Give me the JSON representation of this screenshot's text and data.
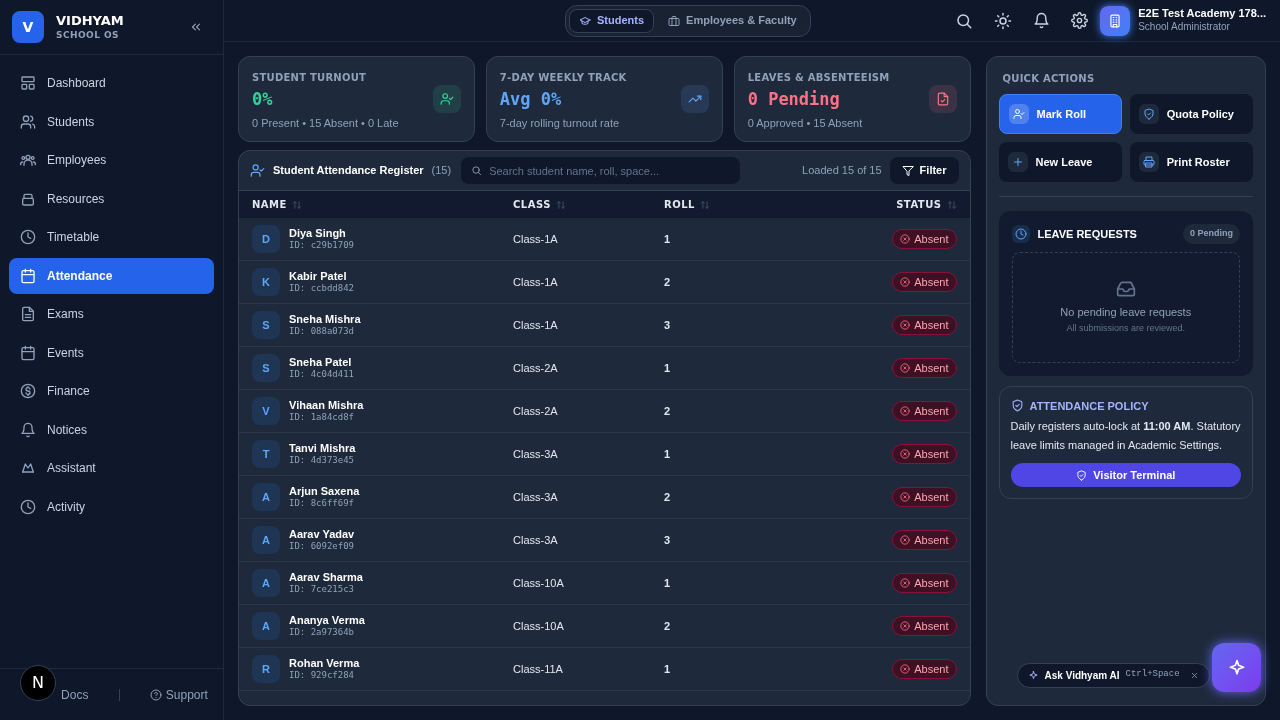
{
  "brand": {
    "logo_letter": "V",
    "name": "VIDHYAM",
    "subtitle": "SCHOOL OS"
  },
  "sidebar": {
    "items": [
      {
        "label": "Dashboard",
        "selected": false
      },
      {
        "label": "Students",
        "selected": false
      },
      {
        "label": "Employees",
        "selected": false
      },
      {
        "label": "Resources",
        "selected": false
      },
      {
        "label": "Timetable",
        "selected": false
      },
      {
        "label": "Attendance",
        "selected": true
      },
      {
        "label": "Exams",
        "selected": false
      },
      {
        "label": "Events",
        "selected": false
      },
      {
        "label": "Finance",
        "selected": false
      },
      {
        "label": "Notices",
        "selected": false
      },
      {
        "label": "Assistant",
        "selected": false
      },
      {
        "label": "Activity",
        "selected": false
      }
    ],
    "footer_links": [
      "Docs",
      "Support"
    ]
  },
  "dev_badge": "N",
  "header": {
    "tabs": [
      {
        "label": "Students",
        "selected": true
      },
      {
        "label": "Employees & Faculty",
        "selected": false
      }
    ],
    "user": {
      "name": "E2E Test Academy 178...",
      "role": "School Administrator"
    }
  },
  "stats": [
    {
      "title": "STUDENT TURNOUT",
      "value": "0%",
      "detail": "0 Present • 15 Absent • 0 Late",
      "color": "#34d399"
    },
    {
      "title": "7-DAY WEEKLY TRACK",
      "value": "Avg 0%",
      "detail": "7-day rolling turnout rate",
      "color": "#60a5fa"
    },
    {
      "title": "LEAVES & ABSENTEEISM",
      "value": "0 Pending",
      "detail": "0 Approved • 15 Absent",
      "color": "#fb7185"
    }
  ],
  "register": {
    "title": "Student Attendance Register",
    "count": "(15)",
    "search_placeholder": "Search student name, roll, space...",
    "loaded": "Loaded 15 of 15",
    "filter": "Filter",
    "columns": [
      "NAME",
      "CLASS",
      "ROLL",
      "STATUS"
    ],
    "rows": [
      {
        "initial": "D",
        "name": "Diya Singh",
        "id": "ID: c29b1709",
        "class": "Class-1A",
        "roll": "1",
        "status": "Absent"
      },
      {
        "initial": "K",
        "name": "Kabir Patel",
        "id": "ID: ccbdd842",
        "class": "Class-1A",
        "roll": "2",
        "status": "Absent"
      },
      {
        "initial": "S",
        "name": "Sneha Mishra",
        "id": "ID: 088a073d",
        "class": "Class-1A",
        "roll": "3",
        "status": "Absent"
      },
      {
        "initial": "S",
        "name": "Sneha Patel",
        "id": "ID: 4c04d411",
        "class": "Class-2A",
        "roll": "1",
        "status": "Absent"
      },
      {
        "initial": "V",
        "name": "Vihaan Mishra",
        "id": "ID: 1a84cd8f",
        "class": "Class-2A",
        "roll": "2",
        "status": "Absent"
      },
      {
        "initial": "T",
        "name": "Tanvi Mishra",
        "id": "ID: 4d373e45",
        "class": "Class-3A",
        "roll": "1",
        "status": "Absent"
      },
      {
        "initial": "A",
        "name": "Arjun Saxena",
        "id": "ID: 8c6ff69f",
        "class": "Class-3A",
        "roll": "2",
        "status": "Absent"
      },
      {
        "initial": "A",
        "name": "Aarav Yadav",
        "id": "ID: 6092ef09",
        "class": "Class-3A",
        "roll": "3",
        "status": "Absent"
      },
      {
        "initial": "A",
        "name": "Aarav Sharma",
        "id": "ID: 7ce215c3",
        "class": "Class-10A",
        "roll": "1",
        "status": "Absent"
      },
      {
        "initial": "A",
        "name": "Ananya Verma",
        "id": "ID: 2a97364b",
        "class": "Class-10A",
        "roll": "2",
        "status": "Absent"
      },
      {
        "initial": "R",
        "name": "Rohan Verma",
        "id": "ID: 929cf284",
        "class": "Class-11A",
        "roll": "1",
        "status": "Absent"
      }
    ]
  },
  "quick_actions": {
    "title": "QUICK ACTIONS",
    "buttons": [
      {
        "label": "Mark Roll",
        "primary": true
      },
      {
        "label": "Quota Policy",
        "primary": false
      },
      {
        "label": "New Leave",
        "primary": false
      },
      {
        "label": "Print Roster",
        "primary": false
      }
    ]
  },
  "leave_requests": {
    "title": "LEAVE REQUESTS",
    "badge": "0 Pending",
    "empty_title": "No pending leave requests",
    "empty_subtitle": "All submissions are reviewed."
  },
  "policy": {
    "title": "ATTENDANCE POLICY",
    "text": "Daily registers auto-lock at **11:00 AM**. Statutory leave limits managed in Academic Settings.",
    "button": "Visitor Terminal"
  },
  "assistant": {
    "label": "Ask Vidhyam AI",
    "shortcut": "Ctrl+Space"
  }
}
